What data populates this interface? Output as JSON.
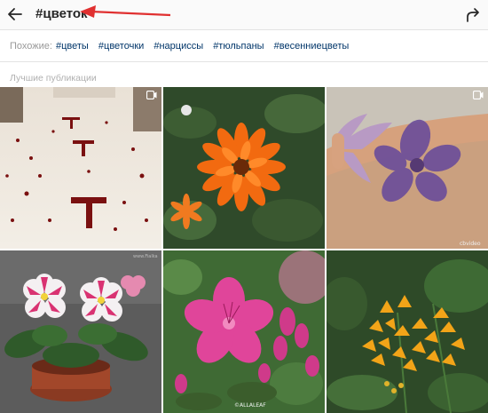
{
  "header": {
    "title": "#цветок",
    "back_icon": "arrow-left-icon",
    "share_icon": "share-arrow-icon"
  },
  "related": {
    "label": "Похожие:",
    "tags": [
      "#цветы",
      "#цветочки",
      "#нарциссы",
      "#тюльпаны",
      "#весенниецветы"
    ]
  },
  "section": {
    "label": "Лучшие публикации"
  },
  "posts": [
    {
      "kind": "video",
      "subject": "rose petals on floor"
    },
    {
      "kind": "photo",
      "subject": "orange calendula"
    },
    {
      "kind": "video",
      "subject": "flower stamp on arm",
      "watermark": "cbvideo"
    },
    {
      "kind": "photo",
      "subject": "violets in pot",
      "watermark": "www.Fialka"
    },
    {
      "kind": "photo",
      "subject": "pink azalea",
      "watermark": "©ALLALEAF"
    },
    {
      "kind": "photo",
      "subject": "yellow milkweed"
    }
  ],
  "colors": {
    "annotation": "#e03030",
    "link": "#003569"
  }
}
